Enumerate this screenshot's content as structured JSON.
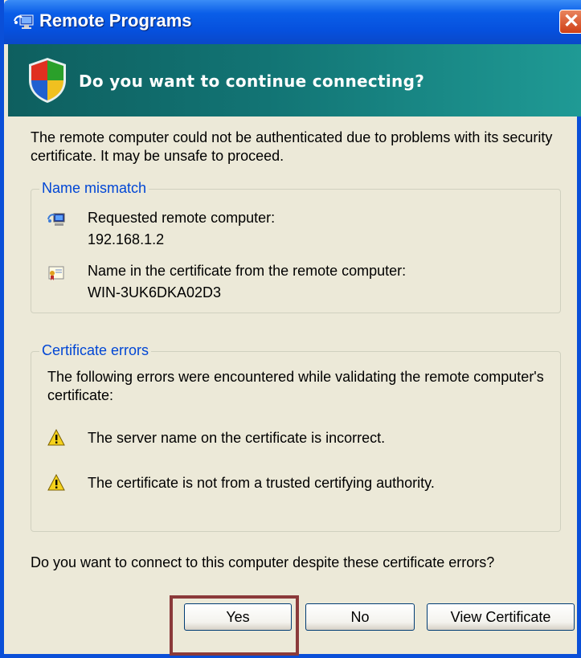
{
  "window": {
    "title": "Remote Programs",
    "close_glyph": "✕"
  },
  "banner": {
    "heading": "Do you want to continue connecting?"
  },
  "intro": "The remote computer could not be authenticated due to problems with its security certificate. It may be unsafe to proceed.",
  "name_mismatch": {
    "label": "Name mismatch",
    "requested_label": "Requested remote computer:",
    "requested_value": "192.168.1.2",
    "cert_name_label": "Name in the certificate from the remote computer:",
    "cert_name_value": "WIN-3UK6DKA02D3"
  },
  "certificate_errors": {
    "label": "Certificate errors",
    "description": "The following errors were encountered while validating the remote computer's certificate:",
    "errors": [
      "The server name on the certificate is incorrect.",
      "The certificate is not from a trusted certifying authority."
    ]
  },
  "question": "Do you want to connect to this computer despite these certificate errors?",
  "buttons": {
    "yes": "Yes",
    "no": "No",
    "view_certificate": "View Certificate"
  },
  "colors": {
    "title_bar": "#0a5ee8",
    "banner": "#127474",
    "group_label": "#0046d5",
    "highlight": "#8b3a3a"
  },
  "icons": [
    "remote-programs-icon",
    "security-shield-icon",
    "network-computer-icon",
    "certificate-icon",
    "warning-icon",
    "close-icon"
  ]
}
